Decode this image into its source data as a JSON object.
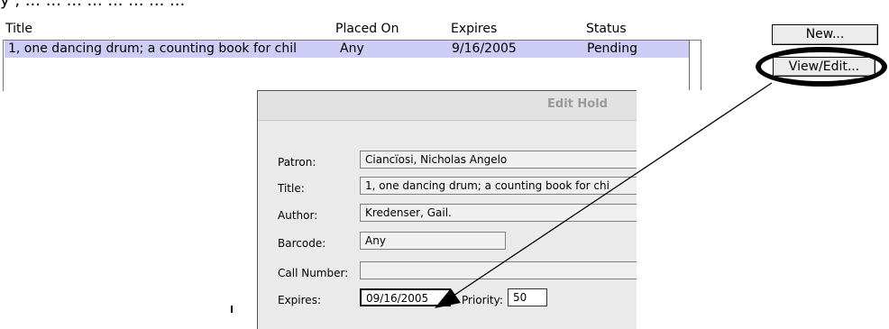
{
  "intro_text_fragments": [
    "y , ... ... ... ... ... ... ... ..."
  ],
  "holds_table": {
    "columns": {
      "title": "Title",
      "placed_on": "Placed On",
      "expires": "Expires",
      "status": "Status"
    },
    "rows": [
      {
        "title": "1, one dancing drum; a counting book for chil",
        "placed_on": "Any",
        "expires": "9/16/2005",
        "status": "Pending"
      }
    ]
  },
  "buttons": {
    "new": "New...",
    "view_edit": "View/Edit..."
  },
  "edit_hold_dialog": {
    "title": "Edit Hold",
    "fields": {
      "patron_label": "Patron:",
      "patron_value": "Ciancïosi, Nicholas Angelo",
      "title_label": "Title:",
      "title_value": "1, one dancing drum; a counting book for chi",
      "author_label": "Author:",
      "author_value": "Kredenser, Gail.",
      "barcode_label": "Barcode:",
      "barcode_value": "Any",
      "call_number_label": "Call Number:",
      "call_number_value": "",
      "expires_label": "Expires:",
      "expires_value": "09/16/2005",
      "priority_label": "Priority:",
      "priority_value": "50"
    }
  },
  "colors": {
    "selected_row": "#ccccf4",
    "dialog_background": "#eaeaea",
    "annotation": "#000000"
  }
}
